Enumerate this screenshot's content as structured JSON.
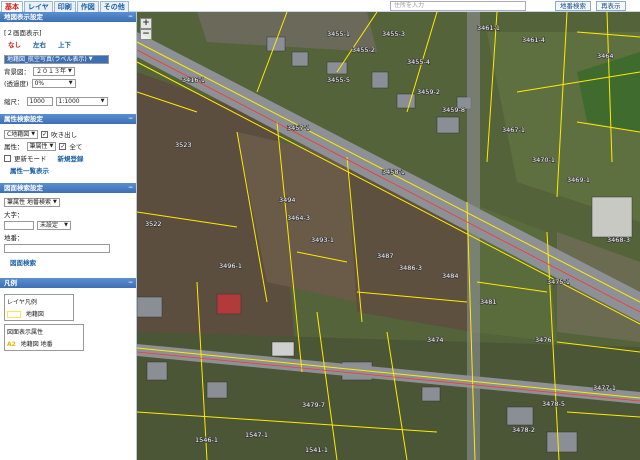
{
  "tabs": [
    "基本",
    "レイヤ",
    "印刷",
    "作図",
    "その他"
  ],
  "search": {
    "placeholder": "住所を入力",
    "button": "地番検索",
    "clear": "再表示"
  },
  "display": {
    "title": "地図表示設定",
    "screen_mode": "[２画面表示]",
    "modes": [
      "なし",
      "左右",
      "上下"
    ],
    "background_select": "地籍図_航空写真(ラベル表示)",
    "background_year_label": "背景図：",
    "background_year": "２０１３年",
    "opacity_label": "(透過度)",
    "opacity": "0%",
    "scale_label": "縮尺：",
    "scale_value": "1000",
    "scale_select": "1:1000"
  },
  "attr_search": {
    "title": "属性検索設定",
    "layer": "C地籍図",
    "balloon": "吹き出し",
    "attr_label": "属性：",
    "attr_select": "筆属性",
    "all": "全て",
    "update_mode": "更新モード",
    "new_register": "新規登録",
    "attr_list": "属性一覧表示"
  },
  "lot_search": {
    "title": "図面検索設定",
    "select1": "筆属性",
    "select2": "地番検索",
    "aza_label": "大字：",
    "aza_select": "未設定",
    "chiban_label": "地番：",
    "search_btn": "図面検索"
  },
  "legend": {
    "title": "凡例",
    "layer_legend": "レイヤ凡例",
    "layer_item": "地籍図",
    "screen_legend": "図面表示属性",
    "screen_swatch_label": "A2",
    "screen_item": "地籍図 地番"
  },
  "map_labels": [
    "3455-1",
    "3455-2",
    "3455-3",
    "3455-4",
    "3461-1",
    "3461-4",
    "3464",
    "3455-5",
    "3416-1",
    "3459-2",
    "3457-1",
    "3459-8",
    "3467-1",
    "3523",
    "3458-1",
    "3469-1",
    "3470-1",
    "3494",
    "3522",
    "3493-1",
    "3487",
    "3486-3",
    "3484",
    "3496-1",
    "3481",
    "3475-1",
    "3476",
    "3474",
    "3477-1",
    "3478-5",
    "3478-2",
    "3479-7",
    "1546-1",
    "1547-1",
    "1541-1",
    "3468-3",
    "3464-3"
  ],
  "colors": {
    "lot_line": "#ffeb00",
    "road_line": "#ff3333",
    "header": "#3d6fb5"
  }
}
